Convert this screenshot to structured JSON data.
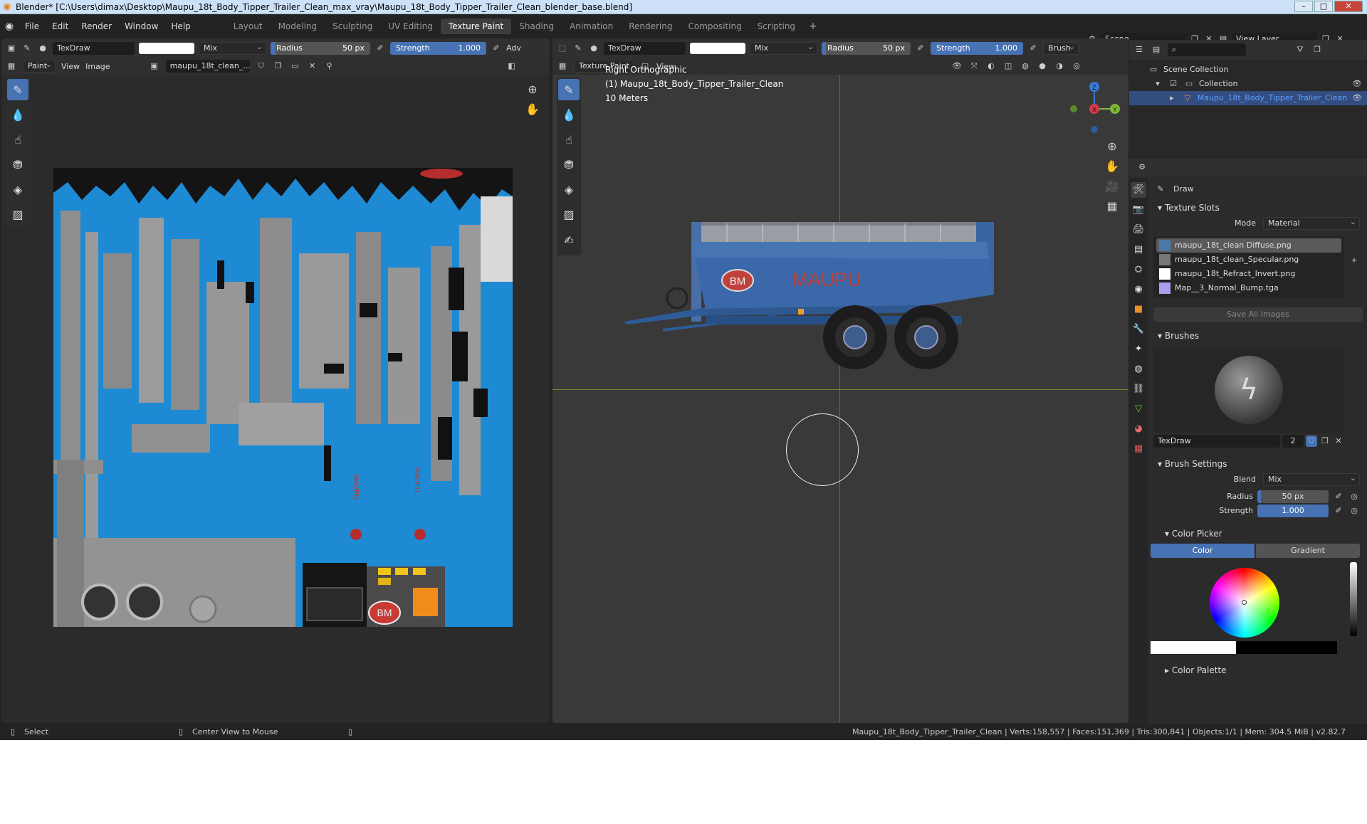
{
  "window": {
    "title": "Blender* [C:\\Users\\dimax\\Desktop\\Maupu_18t_Body_Tipper_Trailer_Clean_max_vray\\Maupu_18t_Body_Tipper_Trailer_Clean_blender_base.blend]",
    "controls": {
      "minimize": "–",
      "maximize": "□",
      "close": "✕"
    }
  },
  "menu": [
    "File",
    "Edit",
    "Render",
    "Window",
    "Help"
  ],
  "workspaces": {
    "tabs": [
      "Layout",
      "Modeling",
      "Sculpting",
      "UV Editing",
      "Texture Paint",
      "Shading",
      "Animation",
      "Rendering",
      "Compositing",
      "Scripting"
    ],
    "active": "Texture Paint",
    "add": "+"
  },
  "scene": {
    "name": "Scene",
    "view_layer": "View Layer"
  },
  "image_editor": {
    "brush": "TexDraw",
    "blend": "Mix",
    "radius_label": "Radius",
    "radius_value": "50 px",
    "strength_label": "Strength",
    "strength_value": "1.000",
    "adv": "Adv",
    "mode": "Paint",
    "view": "View",
    "image": "Image",
    "image_name": "maupu_18t_clean_..."
  },
  "viewport": {
    "brush": "TexDraw",
    "blend": "Mix",
    "radius_label": "Radius",
    "radius_value": "50 px",
    "strength_label": "Strength",
    "strength_value": "1.000",
    "brush_menu": "Brush",
    "mode": "Texture Paint",
    "view": "View",
    "view_name": "Right Orthographic",
    "object_info": "(1) Maupu_18t_Body_Tipper_Trailer_Clean",
    "scale": "10 Meters",
    "axes": {
      "z": "Z",
      "x": "X",
      "y": "Y"
    },
    "trailer_text": {
      "brand": "MAUPU",
      "logo": "BM"
    }
  },
  "outliner": {
    "search_placeholder": "",
    "scene_collection": "Scene Collection",
    "collection": "Collection",
    "object": "Maupu_18t_Body_Tipper_Trailer_Clean"
  },
  "properties": {
    "tool": "Draw",
    "texture_slots": {
      "title": "Texture Slots",
      "mode_label": "Mode",
      "mode_value": "Material",
      "slots": [
        "maupu_18t_clean Diffuse.png",
        "maupu_18t_clean_Specular.png",
        "maupu_18t_Refract_Invert.png",
        "Map__3_Normal_Bump.tga"
      ],
      "save_all": "Save All Images"
    },
    "brushes": {
      "title": "Brushes",
      "name": "TexDraw",
      "users": "2"
    },
    "brush_settings": {
      "title": "Brush Settings",
      "blend_label": "Blend",
      "blend_value": "Mix",
      "radius_label": "Radius",
      "radius_value": "50 px",
      "strength_label": "Strength",
      "strength_value": "1.000"
    },
    "color_picker": {
      "title": "Color Picker",
      "color_tab": "Color",
      "gradient_tab": "Gradient"
    },
    "color_palette": "Color Palette"
  },
  "status": {
    "select": "Select",
    "center": "Center View to Mouse",
    "stats": "Maupu_18t_Body_Tipper_Trailer_Clean | Verts:158,557 | Faces:151,369 | Tris:300,841 | Objects:1/1 | Mem: 304.5 MiB | v2.82.7"
  },
  "colors": {
    "accent": "#4772b3",
    "uv_blue": "#1f8ad4",
    "trailer_blue": "#3a68a8",
    "selected_object": "#5aa0ff"
  }
}
